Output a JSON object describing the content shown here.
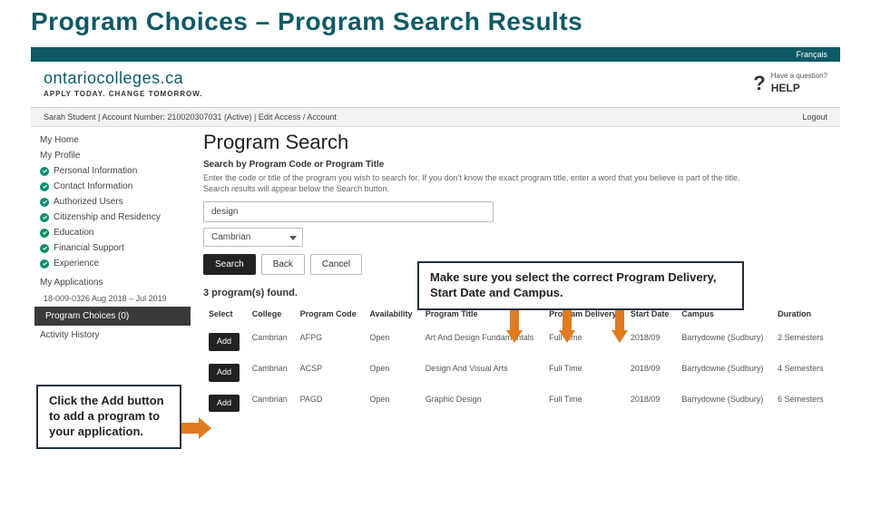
{
  "slide_title": "Program Choices – Program Search Results",
  "lang_link": "Français",
  "logo": "ontariocolleges.ca",
  "logo_tagline": "APPLY TODAY. CHANGE TOMORROW.",
  "help": {
    "qmark": "?",
    "small": "Have a question?",
    "big": "HELP"
  },
  "userbar": {
    "left": "Sarah Student   |   Account Number: 210020307031   (Active)   |   Edit Access / Account",
    "right": "Logout"
  },
  "sidebar": {
    "home": "My Home",
    "profile": "My Profile",
    "items": [
      "Personal Information",
      "Contact Information",
      "Authorized Users",
      "Citizenship and Residency",
      "Education",
      "Financial Support",
      "Experience"
    ],
    "apps": "My Applications",
    "app_num": "18-009-0326   Aug 2018 – Jul 2019",
    "program_choices": "Program Choices (0)",
    "activity": "Activity History"
  },
  "main": {
    "h1": "Program Search",
    "sub_h": "Search by Program Code or Program Title",
    "desc": "Enter the code or title of the program you wish to search for. If you don't know the exact program title, enter a word that you believe is part of the title. Search results will appear below the Search button.",
    "search_value": "design",
    "college_value": "Cambrian",
    "btn_search": "Search",
    "btn_back": "Back",
    "btn_cancel": "Cancel",
    "found": "3 program(s) found.",
    "cols": {
      "select": "Select",
      "college": "College",
      "code": "Program Code",
      "avail": "Availability",
      "title": "Program Title",
      "delivery": "Program Delivery",
      "start": "Start Date",
      "campus": "Campus",
      "duration": "Duration"
    },
    "add_label": "Add",
    "rows": [
      {
        "college": "Cambrian",
        "code": "AFPG",
        "avail": "Open",
        "title": "Art And Design Fundamentals",
        "delivery": "Full Time",
        "start": "2018/09",
        "campus": "Barrydowne (Sudbury)",
        "duration": "2 Semesters"
      },
      {
        "college": "Cambrian",
        "code": "ACSP",
        "avail": "Open",
        "title": "Design And Visual Arts",
        "delivery": "Full Time",
        "start": "2018/09",
        "campus": "Barrydowne (Sudbury)",
        "duration": "4 Semesters"
      },
      {
        "college": "Cambrian",
        "code": "PAGD",
        "avail": "Open",
        "title": "Graphic Design",
        "delivery": "Full Time",
        "start": "2018/09",
        "campus": "Barrydowne (Sudbury)",
        "duration": "6 Semesters"
      }
    ]
  },
  "callouts": {
    "add": "Click the Add button to add a program to your application.",
    "cols": "Make sure you select the correct Program Delivery, Start Date and Campus."
  }
}
